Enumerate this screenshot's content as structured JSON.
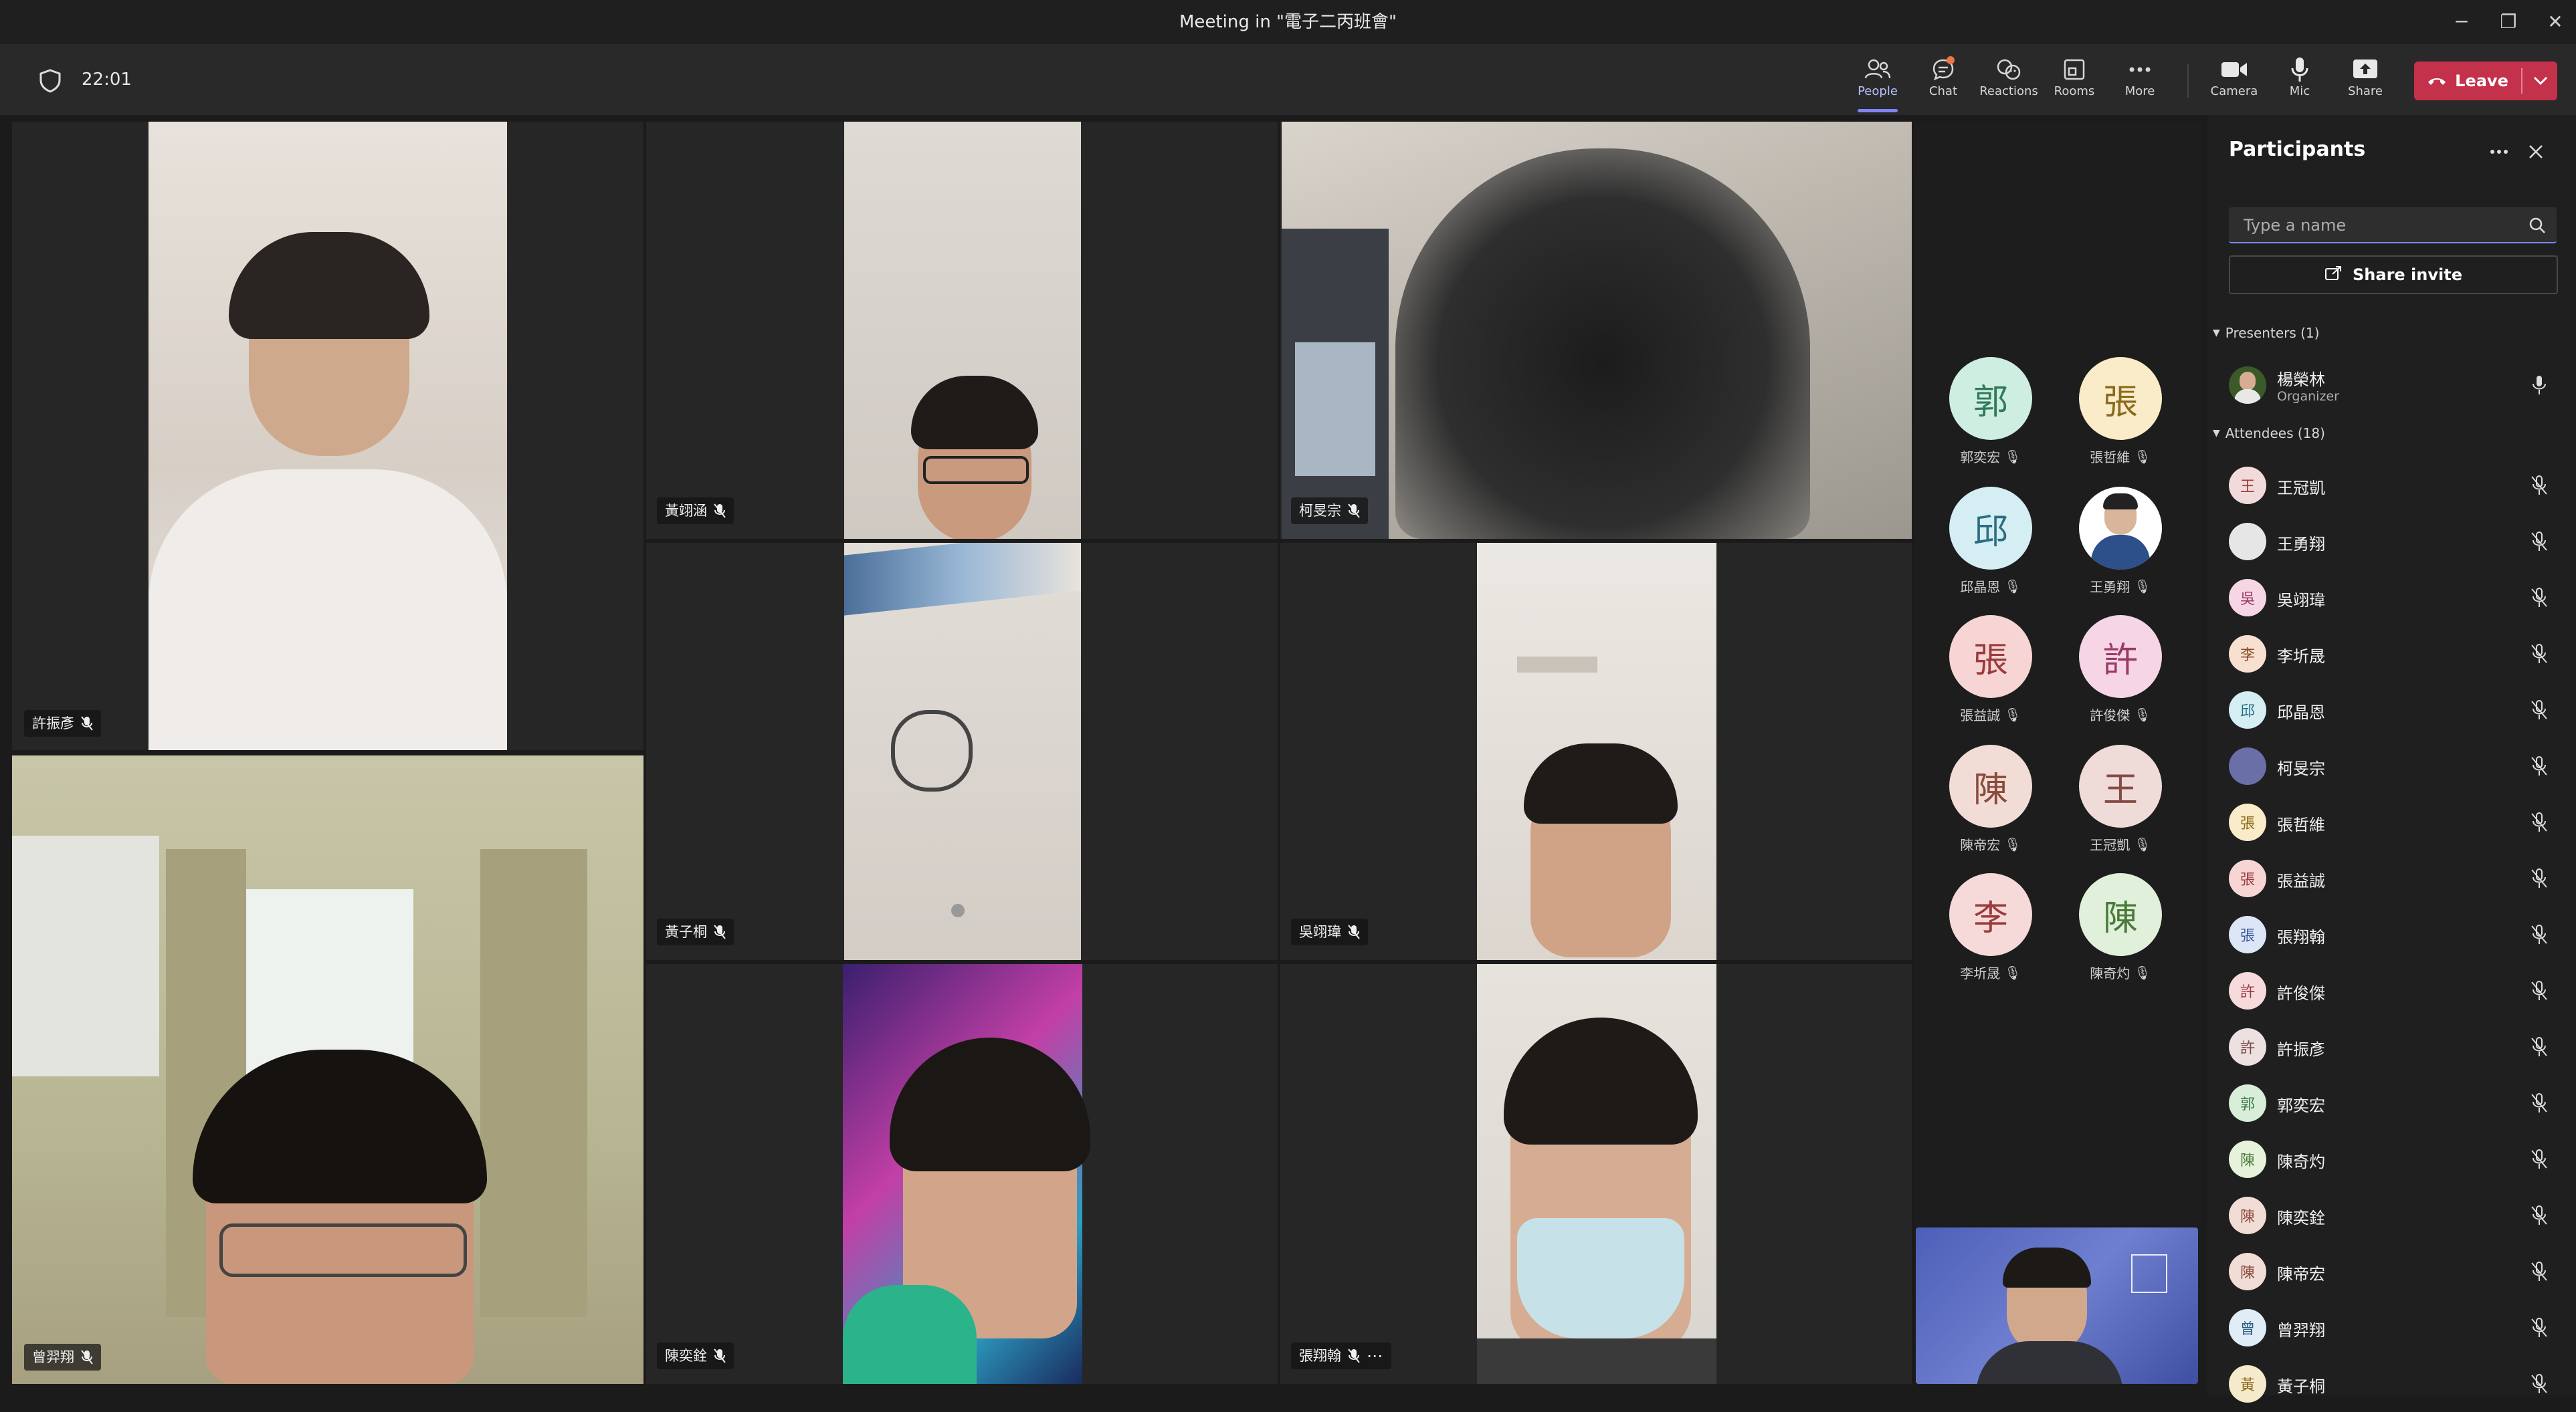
{
  "window": {
    "title": "Meeting in \"電子二丙班會\"",
    "minimize": "─",
    "maximize": "❐",
    "close": "✕"
  },
  "toolbar": {
    "timer": "22:01",
    "buttons": [
      {
        "label": "People",
        "icon": "people-icon"
      },
      {
        "label": "Chat",
        "icon": "chat-icon"
      },
      {
        "label": "Reactions",
        "icon": "reactions-icon"
      },
      {
        "label": "Rooms",
        "icon": "rooms-icon"
      },
      {
        "label": "More",
        "icon": "more-icon"
      },
      {
        "label": "Camera",
        "icon": "camera-icon"
      },
      {
        "label": "Mic",
        "icon": "mic-icon"
      },
      {
        "label": "Share",
        "icon": "share-icon"
      }
    ],
    "leave": "Leave"
  },
  "video_tiles": [
    {
      "name": "許振彥"
    },
    {
      "name": "黃翊涵"
    },
    {
      "name": "柯旻宗"
    },
    {
      "name": "黃子桐"
    },
    {
      "name": "吳翊瑋"
    },
    {
      "name": "曾羿翔"
    },
    {
      "name": "陳奕銓"
    },
    {
      "name": "張翔翰"
    }
  ],
  "avatar_grid": [
    {
      "initial": "郭",
      "name": "郭奕宏"
    },
    {
      "initial": "張",
      "name": "張哲維"
    },
    {
      "initial": "邱",
      "name": "邱晶恩"
    },
    {
      "initial": "",
      "name": "王勇翔"
    },
    {
      "initial": "張",
      "name": "張益誠"
    },
    {
      "initial": "許",
      "name": "許俊傑"
    },
    {
      "initial": "陳",
      "name": "陳帝宏"
    },
    {
      "initial": "王",
      "name": "王冠凱"
    },
    {
      "initial": "李",
      "name": "李圻晟"
    },
    {
      "initial": "陳",
      "name": "陳奇灼"
    }
  ],
  "participants_panel": {
    "title": "Participants",
    "search_placeholder": "Type a name",
    "share_invite": "Share invite",
    "presenters_header": "Presenters (1)",
    "presenter": {
      "name": "楊榮林",
      "role": "Organizer"
    },
    "attendees_header": "Attendees (18)",
    "attendees": [
      {
        "initial": "王",
        "name": "王冠凱"
      },
      {
        "initial": "",
        "name": "王勇翔"
      },
      {
        "initial": "吳",
        "name": "吳翊瑋"
      },
      {
        "initial": "李",
        "name": "李圻晟"
      },
      {
        "initial": "邱",
        "name": "邱晶恩"
      },
      {
        "initial": "",
        "name": "柯旻宗"
      },
      {
        "initial": "張",
        "name": "張哲維"
      },
      {
        "initial": "張",
        "name": "張益誠"
      },
      {
        "initial": "張",
        "name": "張翔翰"
      },
      {
        "initial": "許",
        "name": "許俊傑"
      },
      {
        "initial": "許",
        "name": "許振彥"
      },
      {
        "initial": "郭",
        "name": "郭奕宏"
      },
      {
        "initial": "陳",
        "name": "陳奇灼"
      },
      {
        "initial": "陳",
        "name": "陳奕銓"
      },
      {
        "initial": "陳",
        "name": "陳帝宏"
      },
      {
        "initial": "曾",
        "name": "曾羿翔"
      },
      {
        "initial": "黃",
        "name": "黃子桐"
      }
    ]
  },
  "colors": {
    "accent": "#7f85f5",
    "leave": "#c4314b",
    "notification": "#e97548"
  }
}
